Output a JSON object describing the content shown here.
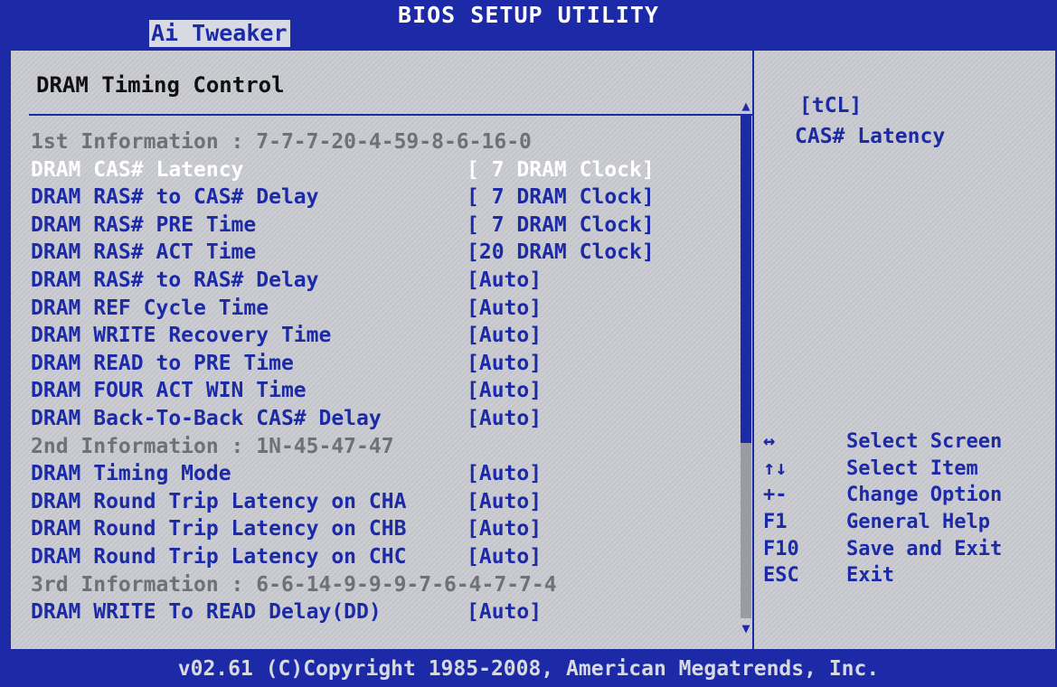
{
  "window": {
    "title": "BIOS SETUP UTILITY"
  },
  "tabs": [
    {
      "label": "Ai Tweaker",
      "active": true
    }
  ],
  "page": {
    "title": "DRAM Timing Control"
  },
  "rows": [
    {
      "label": "1st Information : 7-7-7-20-4-59-8-6-16-0",
      "value": "",
      "type": "info"
    },
    {
      "label": "DRAM CAS# Latency",
      "value": "[ 7 DRAM Clock]",
      "type": "setting",
      "selected": true
    },
    {
      "label": "DRAM RAS# to CAS# Delay",
      "value": "[ 7 DRAM Clock]",
      "type": "setting"
    },
    {
      "label": "DRAM RAS# PRE Time",
      "value": "[ 7 DRAM Clock]",
      "type": "setting"
    },
    {
      "label": "DRAM RAS# ACT Time",
      "value": "[20 DRAM Clock]",
      "type": "setting"
    },
    {
      "label": "DRAM RAS# to RAS# Delay",
      "value": "[Auto]",
      "type": "setting"
    },
    {
      "label": "DRAM REF Cycle Time",
      "value": "[Auto]",
      "type": "setting"
    },
    {
      "label": "DRAM WRITE Recovery Time",
      "value": "[Auto]",
      "type": "setting"
    },
    {
      "label": "DRAM READ to PRE Time",
      "value": "[Auto]",
      "type": "setting"
    },
    {
      "label": "DRAM FOUR ACT WIN Time",
      "value": "[Auto]",
      "type": "setting"
    },
    {
      "label": "DRAM Back-To-Back CAS# Delay",
      "value": "[Auto]",
      "type": "setting"
    },
    {
      "label": "2nd Information : 1N-45-47-47",
      "value": "",
      "type": "info"
    },
    {
      "label": "DRAM Timing Mode",
      "value": "[Auto]",
      "type": "setting"
    },
    {
      "label": "DRAM Round Trip Latency on CHA",
      "value": "[Auto]",
      "type": "setting"
    },
    {
      "label": "DRAM Round Trip Latency on CHB",
      "value": "[Auto]",
      "type": "setting"
    },
    {
      "label": "DRAM Round Trip Latency on CHC",
      "value": "[Auto]",
      "type": "setting"
    },
    {
      "label": "3rd Information : 6-6-14-9-9-9-7-6-4-7-7-4",
      "value": "",
      "type": "info"
    },
    {
      "label": "DRAM WRITE To READ Delay(DD)",
      "value": "[Auto]",
      "type": "setting"
    }
  ],
  "help": {
    "code": "[tCL]",
    "text": "CAS# Latency"
  },
  "keys": [
    {
      "key": "↔",
      "desc": "Select Screen"
    },
    {
      "key": "↑↓",
      "desc": "Select Item"
    },
    {
      "key": "+-",
      "desc": "Change Option"
    },
    {
      "key": "F1",
      "desc": "General Help"
    },
    {
      "key": "F10",
      "desc": "Save and Exit"
    },
    {
      "key": "ESC",
      "desc": "Exit"
    }
  ],
  "footer": "v02.61 (C)Copyright 1985-2008, American Megatrends, Inc.",
  "icons": {
    "scroll_up": "scroll-up-arrow-icon",
    "scroll_down": "scroll-down-arrow-icon"
  },
  "colors": {
    "bios_blue": "#1c2aa8",
    "panel_gray": "#c9cbd1",
    "highlight": "#ffffff",
    "info_gray": "#707078"
  }
}
